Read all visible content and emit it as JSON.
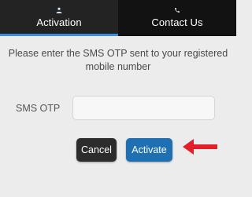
{
  "tabs": [
    {
      "label": "Activation",
      "icon": "person-icon",
      "active": true
    },
    {
      "label": "Contact Us",
      "icon": "phone-icon",
      "active": false
    }
  ],
  "message": "Please enter the SMS OTP sent to your registered mobile number",
  "otp": {
    "label": "SMS OTP",
    "value": "",
    "placeholder": ""
  },
  "buttons": {
    "cancel": "Cancel",
    "activate": "Activate"
  },
  "colors": {
    "tab_bar": "#121212",
    "active_tab_indicator": "#3d8ed6",
    "activate_button": "#1f6fb3",
    "cancel_button": "#2c2c2c",
    "pointer_arrow": "#e3202a"
  },
  "annotation": {
    "icon": "red-arrow-icon"
  }
}
